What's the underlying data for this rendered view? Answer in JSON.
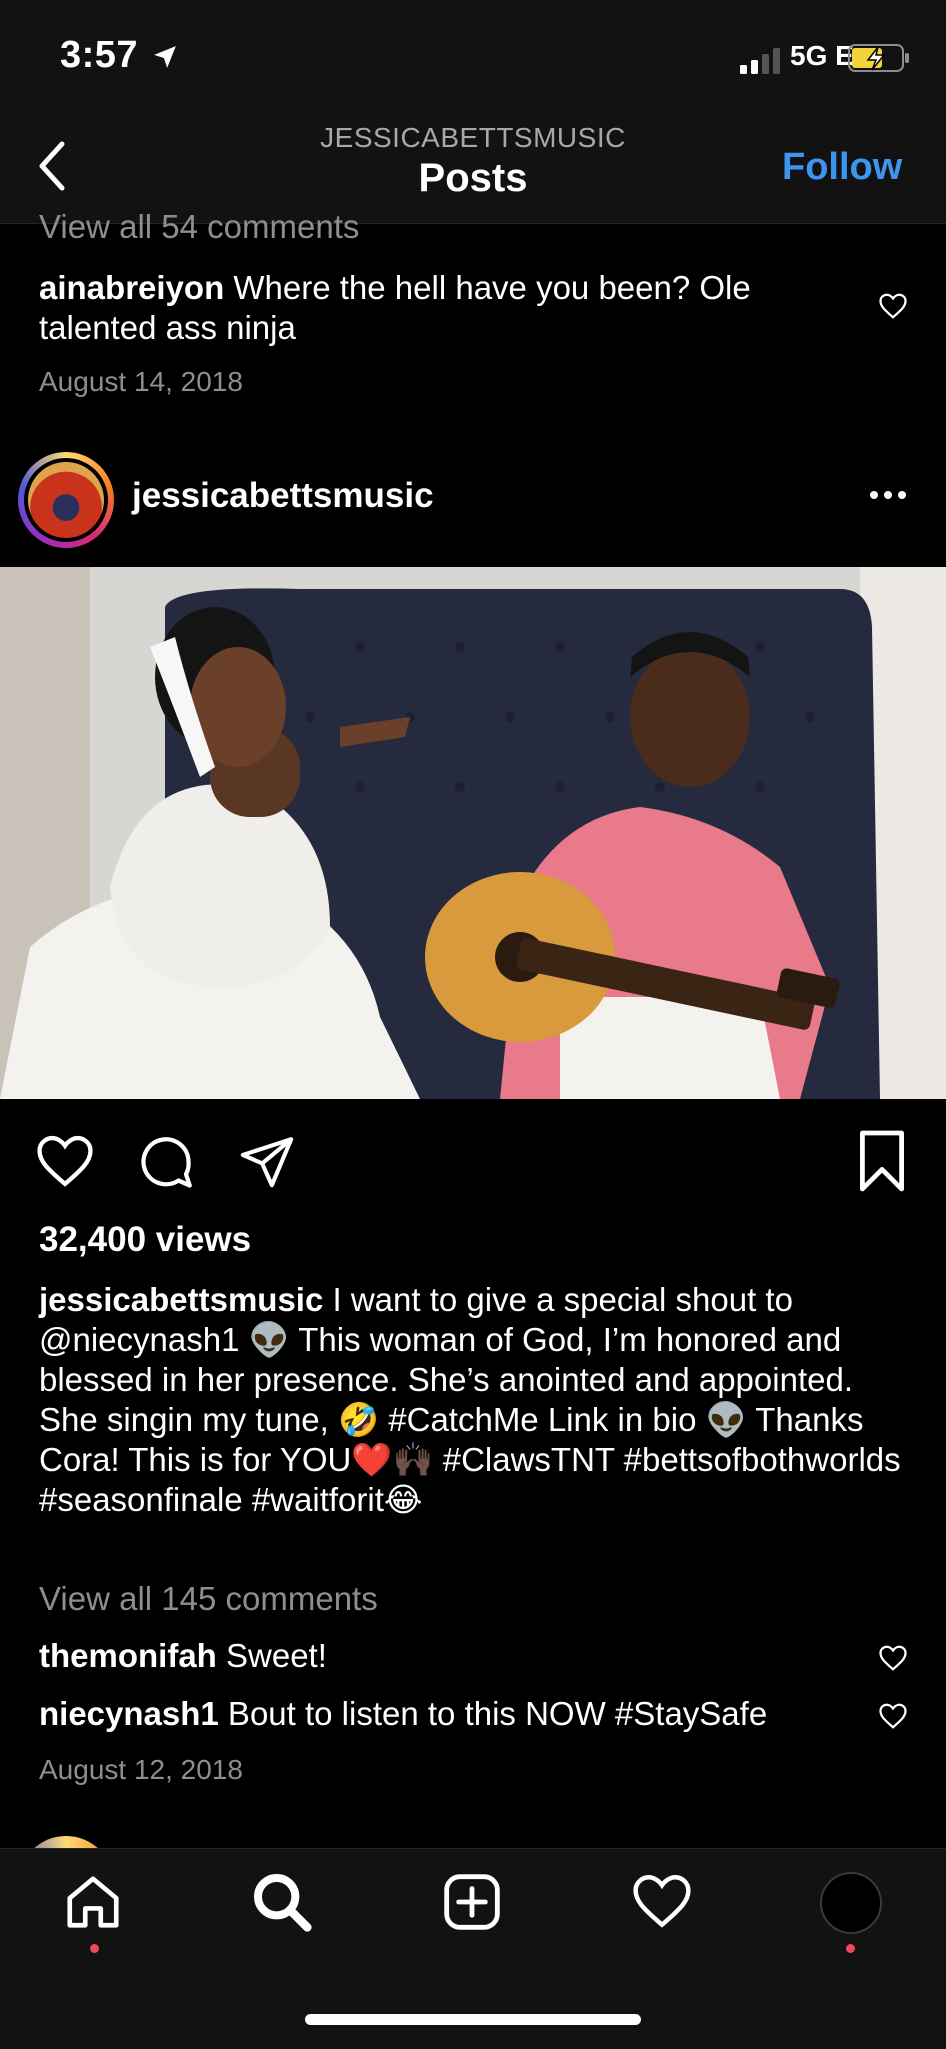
{
  "status": {
    "time": "3:57",
    "network": "5G E"
  },
  "header": {
    "account": "JESSICABETTSMUSIC",
    "title": "Posts",
    "follow": "Follow"
  },
  "prev_post": {
    "view_all": "View all 54 comments",
    "comment": {
      "user": "ainabreiyon",
      "text": " Where the hell have you been? Ole talented ass ninja"
    },
    "date": "August 14, 2018"
  },
  "post": {
    "username": "jessicabettsmusic",
    "views": "32,400 views",
    "caption_user": "jessicabettsmusic",
    "caption_text": " I want to give a special shout to @niecynash1 👽 This woman of God, I’m honored and blessed in her presence. She’s anointed and appointed. She singin my tune, 🤣 #CatchMe Link in bio 👽 Thanks Cora! This is for YOU❤️🙌🏿 #ClawsTNT #bettsofbothworlds #seasonfinale #waitforit😂",
    "view_all": "View all 145 comments",
    "comments": [
      {
        "user": "themonifah",
        "text": " Sweet!"
      },
      {
        "user": "niecynash1",
        "text": " Bout to listen to this NOW #StaySafe"
      }
    ],
    "date": "August 12, 2018"
  },
  "icons": {
    "back": "chevron-left-icon",
    "like": "heart-icon",
    "comment": "comment-bubble-icon",
    "share": "paper-plane-icon",
    "save": "bookmark-icon",
    "more": "more-dots-icon",
    "nav": [
      "home-icon",
      "search-icon",
      "add-post-icon",
      "activity-heart-icon",
      "profile-avatar"
    ]
  },
  "colors": {
    "accent": "#3d95ef",
    "notification": "#ed4956",
    "background": "#000000"
  }
}
